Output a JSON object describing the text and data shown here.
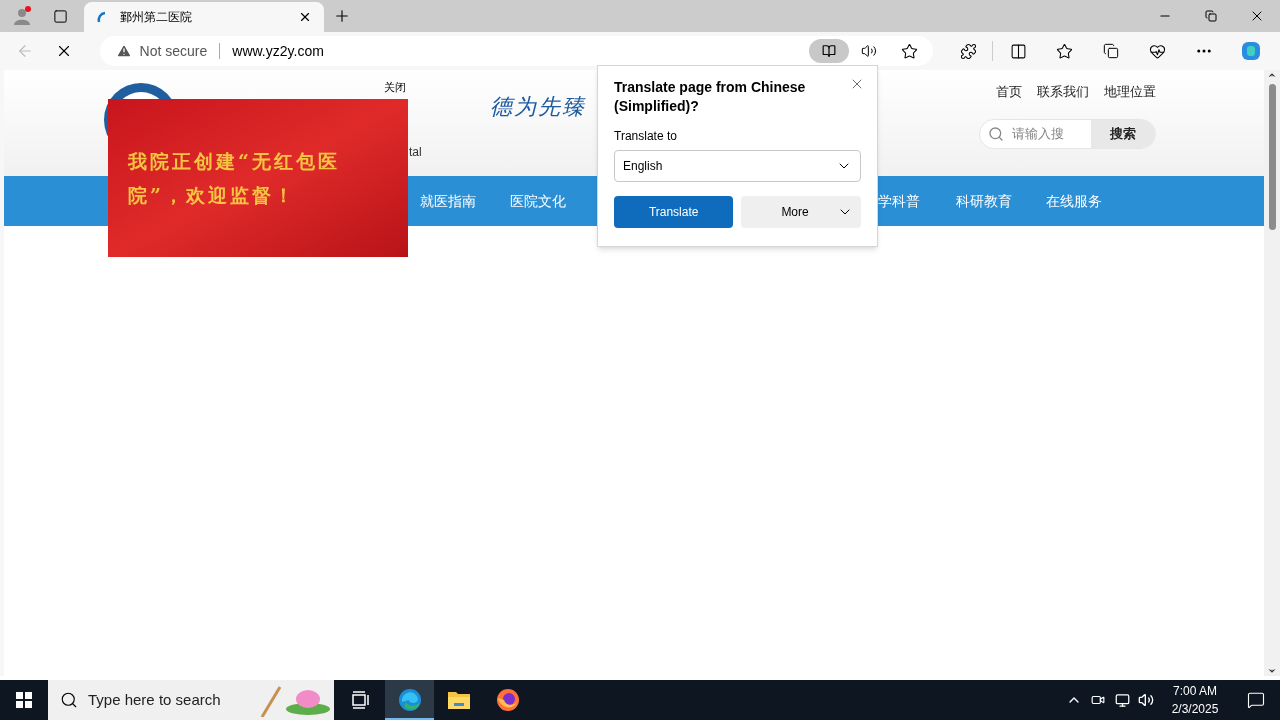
{
  "browser": {
    "tab": {
      "title": "鄞州第二医院",
      "selected": true
    },
    "address": {
      "security": "Not secure",
      "url": "www.yz2y.com"
    }
  },
  "page": {
    "subtitle_fragment": "tal",
    "motto": "德为先臻",
    "top_links": [
      "首页",
      "联系我们",
      "地理位置"
    ],
    "search": {
      "placeholder": "请输入搜",
      "button": "搜索"
    },
    "nav": [
      "就医指南",
      "医院文化",
      "学科普",
      "科研教育",
      "在线服务"
    ],
    "popup": {
      "close": "关闭",
      "text": "我院正创建“无红包医院”，欢迎监督！"
    }
  },
  "translate_dialog": {
    "title": "Translate page from Chinese (Simplified)?",
    "label": "Translate to",
    "language": "English",
    "primary": "Translate",
    "secondary": "More"
  },
  "taskbar": {
    "search_placeholder": "Type here to search",
    "apps": [
      {
        "kind": "taskview",
        "selected": false
      },
      {
        "kind": "edge",
        "selected": true
      },
      {
        "kind": "explorer",
        "selected": false
      },
      {
        "kind": "firefox",
        "selected": false
      }
    ],
    "time": "7:00 AM",
    "date": "2/3/2025"
  }
}
